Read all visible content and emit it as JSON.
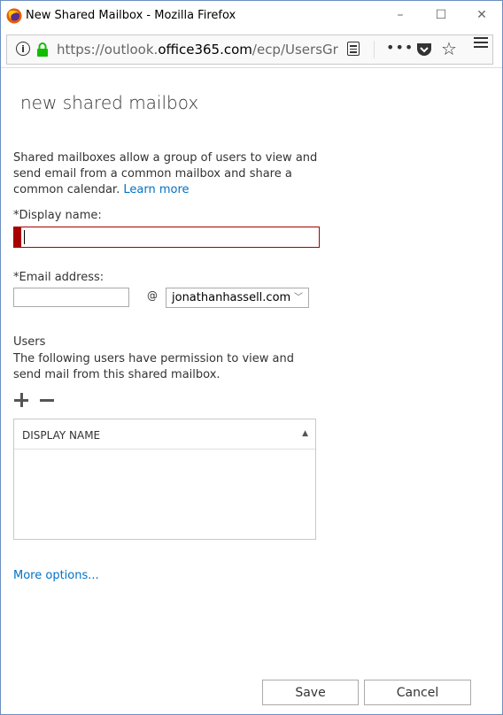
{
  "window": {
    "title": "New Shared Mailbox - Mozilla Firefox",
    "minimize": "–",
    "maximize": "☐",
    "close": "✕"
  },
  "browser": {
    "url_prefix": "https://outlook.",
    "url_domain": "office365.com",
    "url_rest": "/ecp/UsersGroup",
    "more_glyph": "•••",
    "star_glyph": "☆"
  },
  "page": {
    "title": "new shared mailbox",
    "description": "Shared mailboxes allow a group of users to view and send email from a common mailbox and share a common calendar.",
    "learn_more": "Learn more",
    "display_name_label": "*Display name:",
    "display_name_value": "",
    "email_label": "*Email address:",
    "email_value": "",
    "at_sign": "@",
    "domain_selected": "jonathanhassell.com",
    "users_heading": "Users",
    "users_description": "The following users have permission to view and send mail from this shared mailbox.",
    "table_column": "DISPLAY NAME",
    "more_options": "More options...",
    "save": "Save",
    "cancel": "Cancel"
  },
  "colors": {
    "accent_link": "#0072c6",
    "error_border": "#a80000"
  }
}
